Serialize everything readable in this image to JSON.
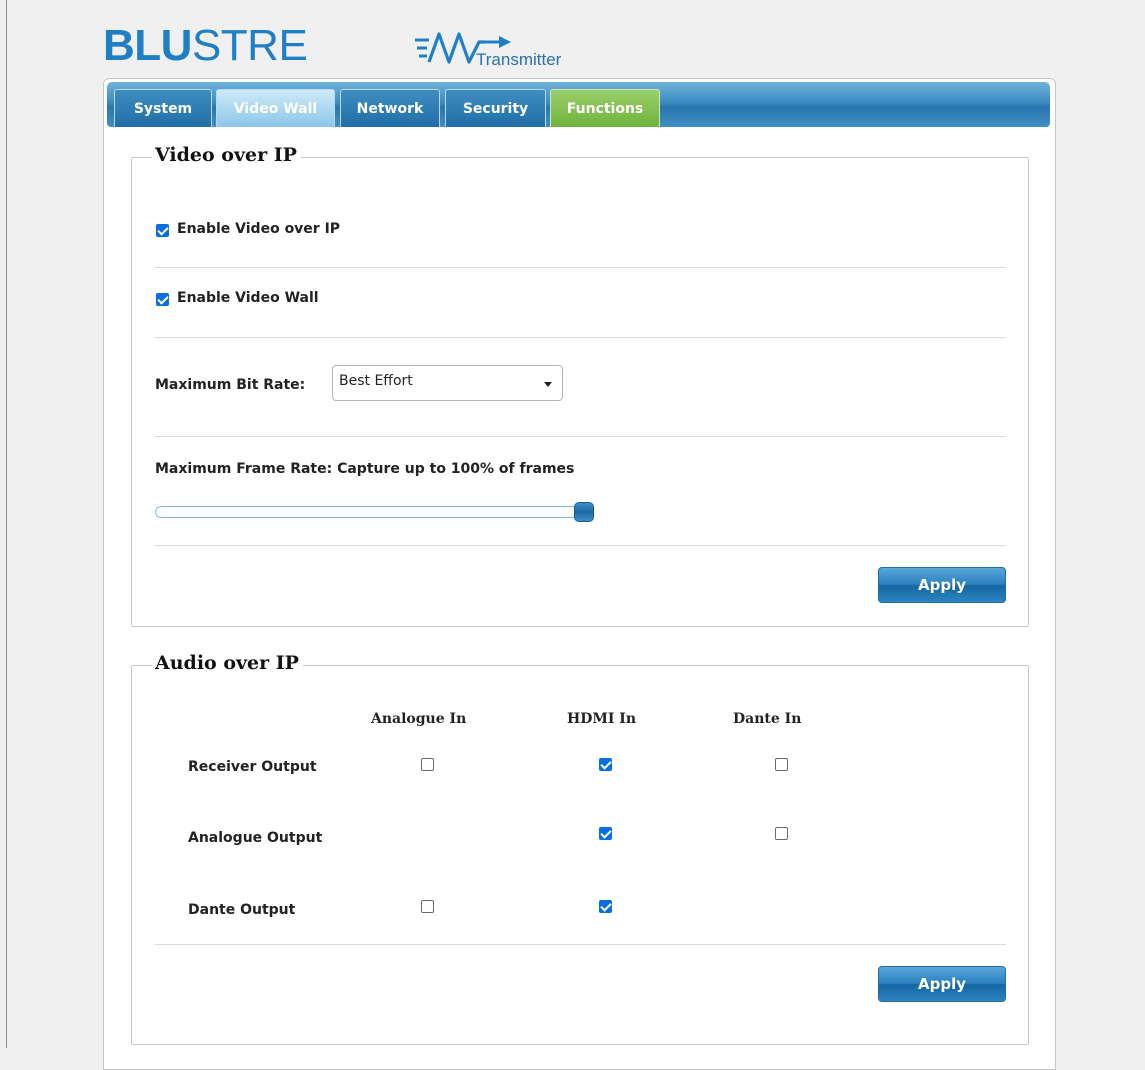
{
  "logo": {
    "brand_part1": "BLU",
    "brand_part2": "STRE",
    "subtitle": "Transmitter"
  },
  "tabs": [
    {
      "label": "System",
      "active": false
    },
    {
      "label": "Video Wall",
      "active": true
    },
    {
      "label": "Network",
      "active": false
    },
    {
      "label": "Security",
      "active": false
    },
    {
      "label": "Functions",
      "active": false,
      "color": "#7dbf4a"
    }
  ],
  "video": {
    "legend": "Video over IP",
    "enable_video_label": "Enable Video over IP",
    "enable_video_checked": true,
    "enable_wall_label": "Enable Video Wall",
    "enable_wall_checked": true,
    "bitrate_label": "Maximum Bit Rate:",
    "bitrate_value": "Best Effort",
    "framerate_label": "Maximum Frame Rate: Capture up to 100% of frames",
    "framerate_percent": 100,
    "apply_label": "Apply"
  },
  "audio": {
    "legend": "Audio over IP",
    "columns": [
      "Analogue In",
      "HDMI In",
      "Dante In"
    ],
    "rows": [
      {
        "label": "Receiver Output",
        "cells": [
          false,
          true,
          false
        ]
      },
      {
        "label": "Analogue Output",
        "cells": [
          null,
          true,
          false
        ]
      },
      {
        "label": "Dante Output",
        "cells": [
          false,
          true,
          null
        ]
      }
    ],
    "apply_label": "Apply"
  },
  "colors": {
    "accent": "#2a80be",
    "brand": "#1f7fc6",
    "checkbox": "#0b6ee0"
  }
}
